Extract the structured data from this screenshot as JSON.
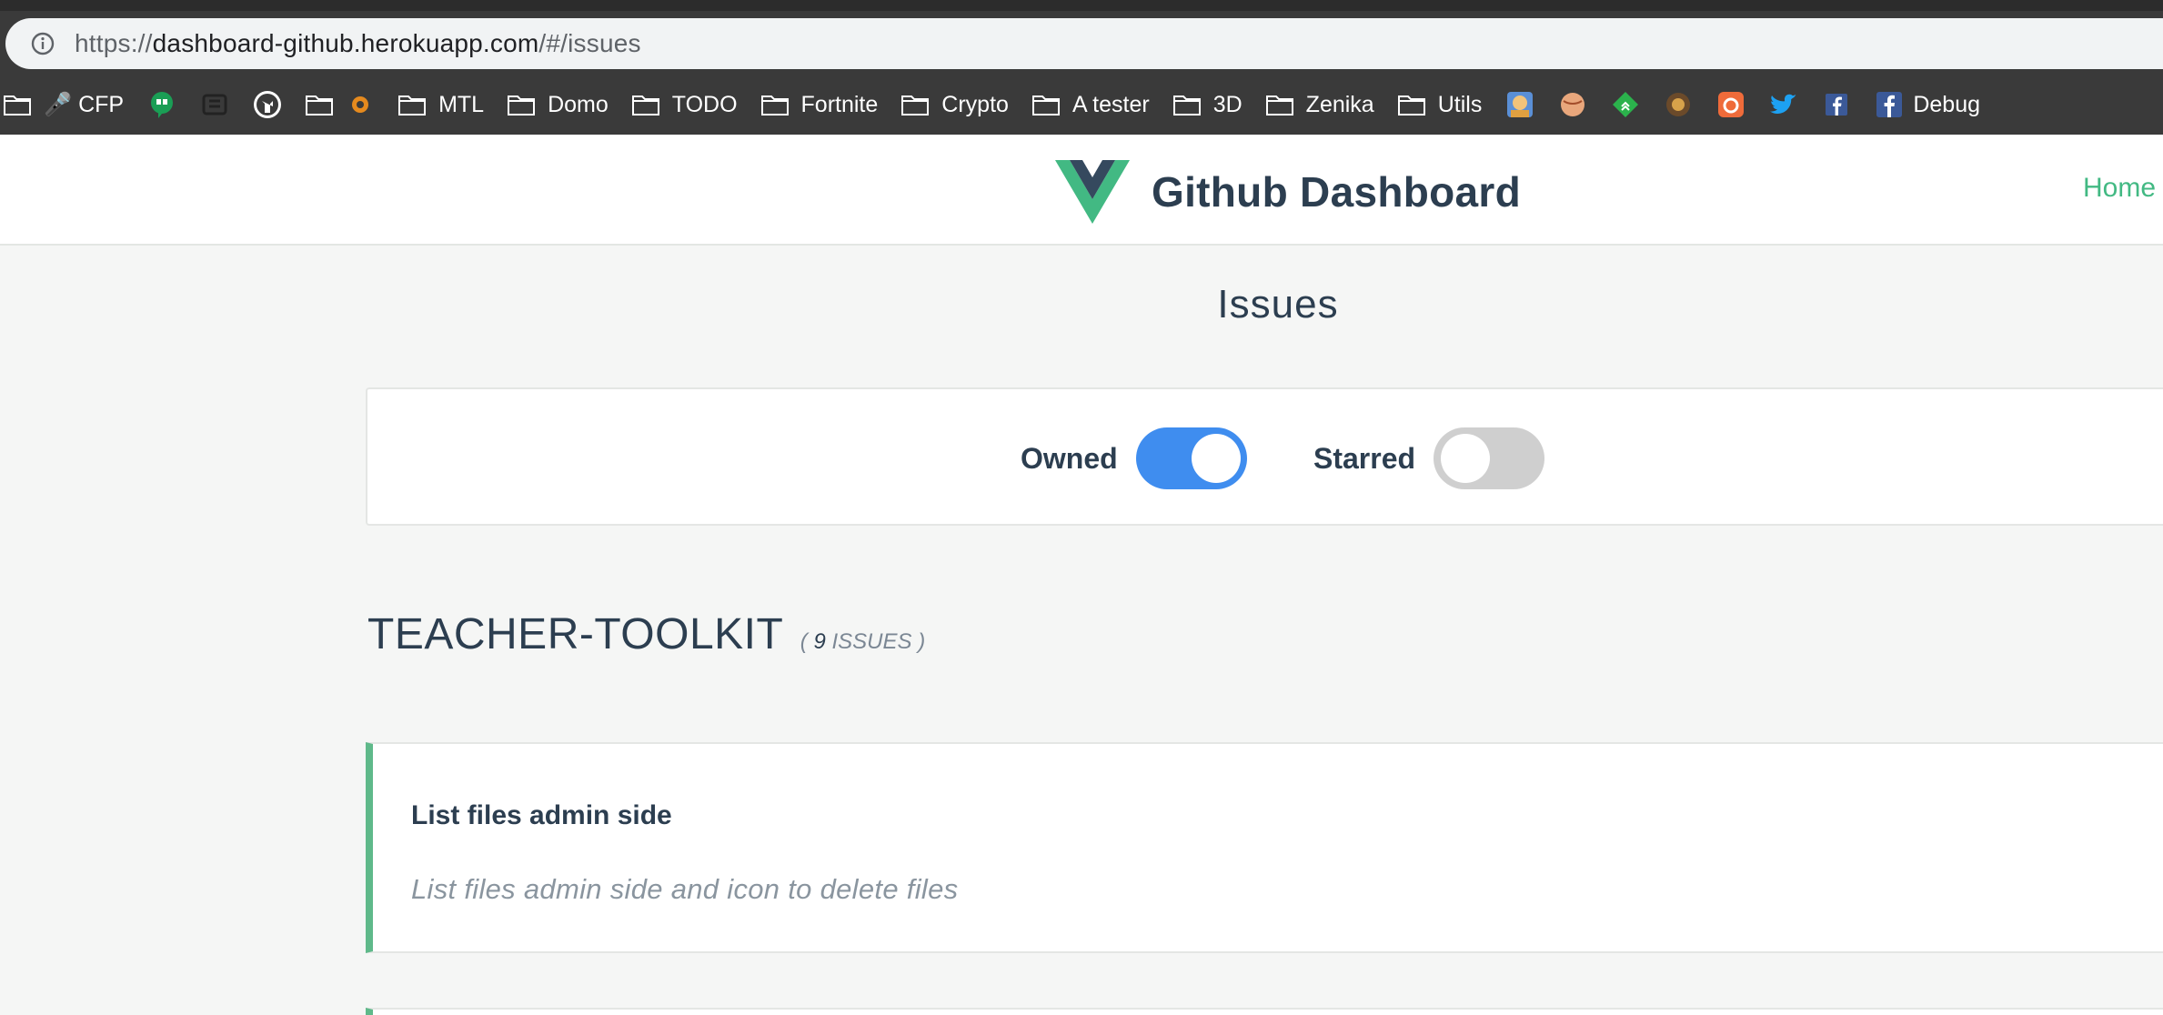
{
  "browser": {
    "url_scheme": "https://",
    "url_host": "dashboard-github.herokuapp.com",
    "url_path": "/#/issues",
    "bookmarks": {
      "cfp": "🎤 CFP",
      "mtl": "MTL",
      "domo": "Domo",
      "todo": "TODO",
      "fortnite": "Fortnite",
      "crypto": "Crypto",
      "a_tester": "A tester",
      "three_d": "3D",
      "zenika": "Zenika",
      "utils": "Utils",
      "debug": "Debug"
    }
  },
  "header": {
    "title": "Github Dashboard",
    "nav_home": "Home"
  },
  "page": {
    "title": "Issues"
  },
  "filters": {
    "owned": {
      "label": "Owned",
      "enabled": true
    },
    "starred": {
      "label": "Starred",
      "enabled": false
    }
  },
  "repo": {
    "name": "TEACHER-TOOLKIT",
    "count_open": "( ",
    "count": "9",
    "count_suffix": " ISSUES )"
  },
  "issues": [
    {
      "title": "List files admin side",
      "body": "List files admin side and icon to delete files"
    }
  ],
  "colors": {
    "accent_green": "#42b983",
    "toggle_on": "#3f8def",
    "toggle_off": "#cfcfcf",
    "text_dark": "#2c3e50"
  }
}
